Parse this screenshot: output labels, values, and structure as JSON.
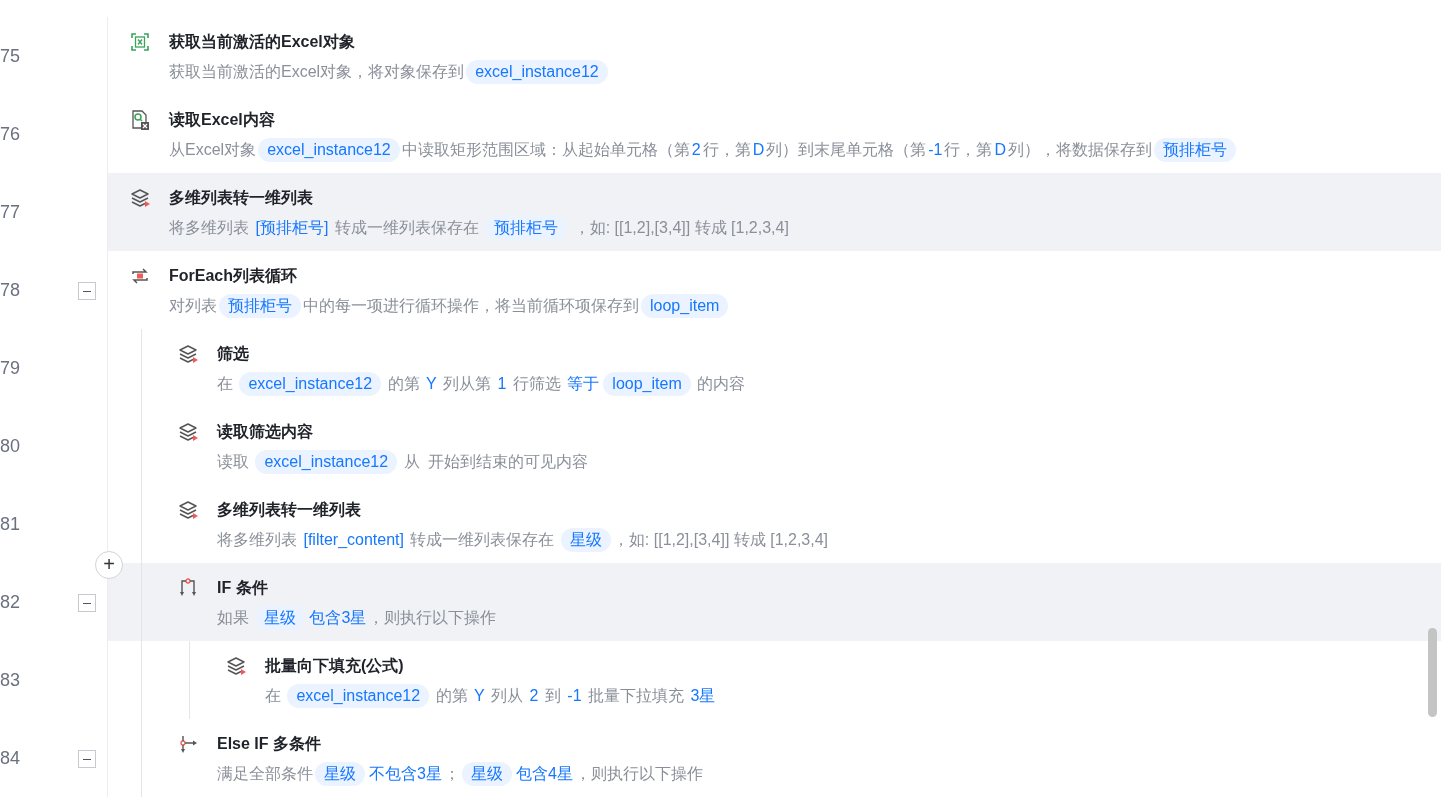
{
  "steps": [
    {
      "number": "75",
      "kind": "excel-get",
      "title": "获取当前激活的Excel对象",
      "highlighted": false,
      "description": [
        {
          "kind": "text",
          "text": "获取当前激活的Excel对象，将对象保存到"
        },
        {
          "kind": "var",
          "text": "excel_instance12"
        }
      ]
    },
    {
      "number": "76",
      "kind": "excel-read",
      "title": "读取Excel内容",
      "highlighted": false,
      "description": [
        {
          "kind": "text",
          "text": "从Excel对象"
        },
        {
          "kind": "var",
          "text": "excel_instance12"
        },
        {
          "kind": "text",
          "text": "中读取矩形范围区域：从起始单元格（第"
        },
        {
          "kind": "value",
          "text": "2"
        },
        {
          "kind": "text",
          "text": "行，第"
        },
        {
          "kind": "value",
          "text": "D"
        },
        {
          "kind": "text",
          "text": "列）到末尾单元格（第"
        },
        {
          "kind": "value",
          "text": "-1"
        },
        {
          "kind": "text",
          "text": "行，第"
        },
        {
          "kind": "value",
          "text": "D"
        },
        {
          "kind": "text",
          "text": "列），将数据保存到"
        },
        {
          "kind": "var",
          "text": "预排柜号"
        }
      ]
    },
    {
      "number": "77",
      "kind": "layers",
      "title": "多维列表转一维列表",
      "highlighted": true,
      "description": [
        {
          "kind": "text",
          "text": "将多维列表 "
        },
        {
          "kind": "value",
          "text": "[预排柜号]"
        },
        {
          "kind": "text",
          "text": " 转成一维列表保存在 "
        },
        {
          "kind": "var",
          "text": "预排柜号"
        },
        {
          "kind": "text",
          "text": " ，如: [[1,2],[3,4]] 转成 [1,2,3,4]"
        }
      ]
    },
    {
      "number": "78",
      "kind": "loop",
      "title": "ForEach列表循环",
      "highlighted": false,
      "expanded": true,
      "description": [
        {
          "kind": "text",
          "text": "对列表"
        },
        {
          "kind": "var",
          "text": "预排柜号"
        },
        {
          "kind": "text",
          "text": "中的每一项进行循环操作，将当前循环项保存到"
        },
        {
          "kind": "var",
          "text": "loop_item"
        }
      ],
      "children": [
        {
          "number": "79",
          "kind": "layers",
          "title": "筛选",
          "highlighted": false,
          "description": [
            {
              "kind": "text",
              "text": "在 "
            },
            {
              "kind": "var",
              "text": "excel_instance12"
            },
            {
              "kind": "text",
              "text": " 的第 "
            },
            {
              "kind": "value",
              "text": "Y"
            },
            {
              "kind": "text",
              "text": " 列从第 "
            },
            {
              "kind": "value",
              "text": "1"
            },
            {
              "kind": "text",
              "text": " 行筛选 "
            },
            {
              "kind": "value",
              "text": "等于"
            },
            {
              "kind": "var",
              "text": "loop_item"
            },
            {
              "kind": "text",
              "text": " 的内容"
            }
          ]
        },
        {
          "number": "80",
          "kind": "layers",
          "title": "读取筛选内容",
          "highlighted": false,
          "description": [
            {
              "kind": "text",
              "text": "读取 "
            },
            {
              "kind": "var",
              "text": "excel_instance12"
            },
            {
              "kind": "text",
              "text": " 从  开始到结束的可见内容"
            }
          ]
        },
        {
          "number": "81",
          "kind": "layers",
          "title": "多维列表转一维列表",
          "highlighted": false,
          "add_button": "+",
          "description": [
            {
              "kind": "text",
              "text": "将多维列表 "
            },
            {
              "kind": "value",
              "text": "[filter_content]"
            },
            {
              "kind": "text",
              "text": " 转成一维列表保存在 "
            },
            {
              "kind": "var",
              "text": "星级"
            },
            {
              "kind": "text",
              "text": "，如: [[1,2],[3,4]] 转成 [1,2,3,4]"
            }
          ]
        },
        {
          "number": "82",
          "kind": "if",
          "title": "IF 条件",
          "highlighted": true,
          "expanded": true,
          "description": [
            {
              "kind": "text",
              "text": "如果 "
            },
            {
              "kind": "var",
              "text": "星级"
            },
            {
              "kind": "value",
              "text": "包含3星"
            },
            {
              "kind": "text",
              "text": "，则执行以下操作"
            }
          ],
          "children": [
            {
              "number": "83",
              "kind": "layers",
              "title": "批量向下填充(公式)",
              "highlighted": false,
              "description": [
                {
                  "kind": "text",
                  "text": "在 "
                },
                {
                  "kind": "var",
                  "text": "excel_instance12"
                },
                {
                  "kind": "text",
                  "text": " 的第 "
                },
                {
                  "kind": "value",
                  "text": "Y"
                },
                {
                  "kind": "text",
                  "text": " 列从 "
                },
                {
                  "kind": "value",
                  "text": "2"
                },
                {
                  "kind": "text",
                  "text": " 到 "
                },
                {
                  "kind": "value",
                  "text": "-1"
                },
                {
                  "kind": "text",
                  "text": " 批量下拉填充 "
                },
                {
                  "kind": "value",
                  "text": "3星"
                }
              ]
            }
          ]
        },
        {
          "number": "84",
          "kind": "elseif",
          "title": "Else IF 多条件",
          "highlighted": false,
          "expanded": true,
          "description": [
            {
              "kind": "text",
              "text": "满足全部条件"
            },
            {
              "kind": "var",
              "text": "星级"
            },
            {
              "kind": "value",
              "text": "不包含3星"
            },
            {
              "kind": "text",
              "text": "；"
            },
            {
              "kind": "var",
              "text": "星级"
            },
            {
              "kind": "value",
              "text": "包含4星"
            },
            {
              "kind": "text",
              "text": "，则执行以下操作"
            }
          ]
        }
      ]
    }
  ]
}
